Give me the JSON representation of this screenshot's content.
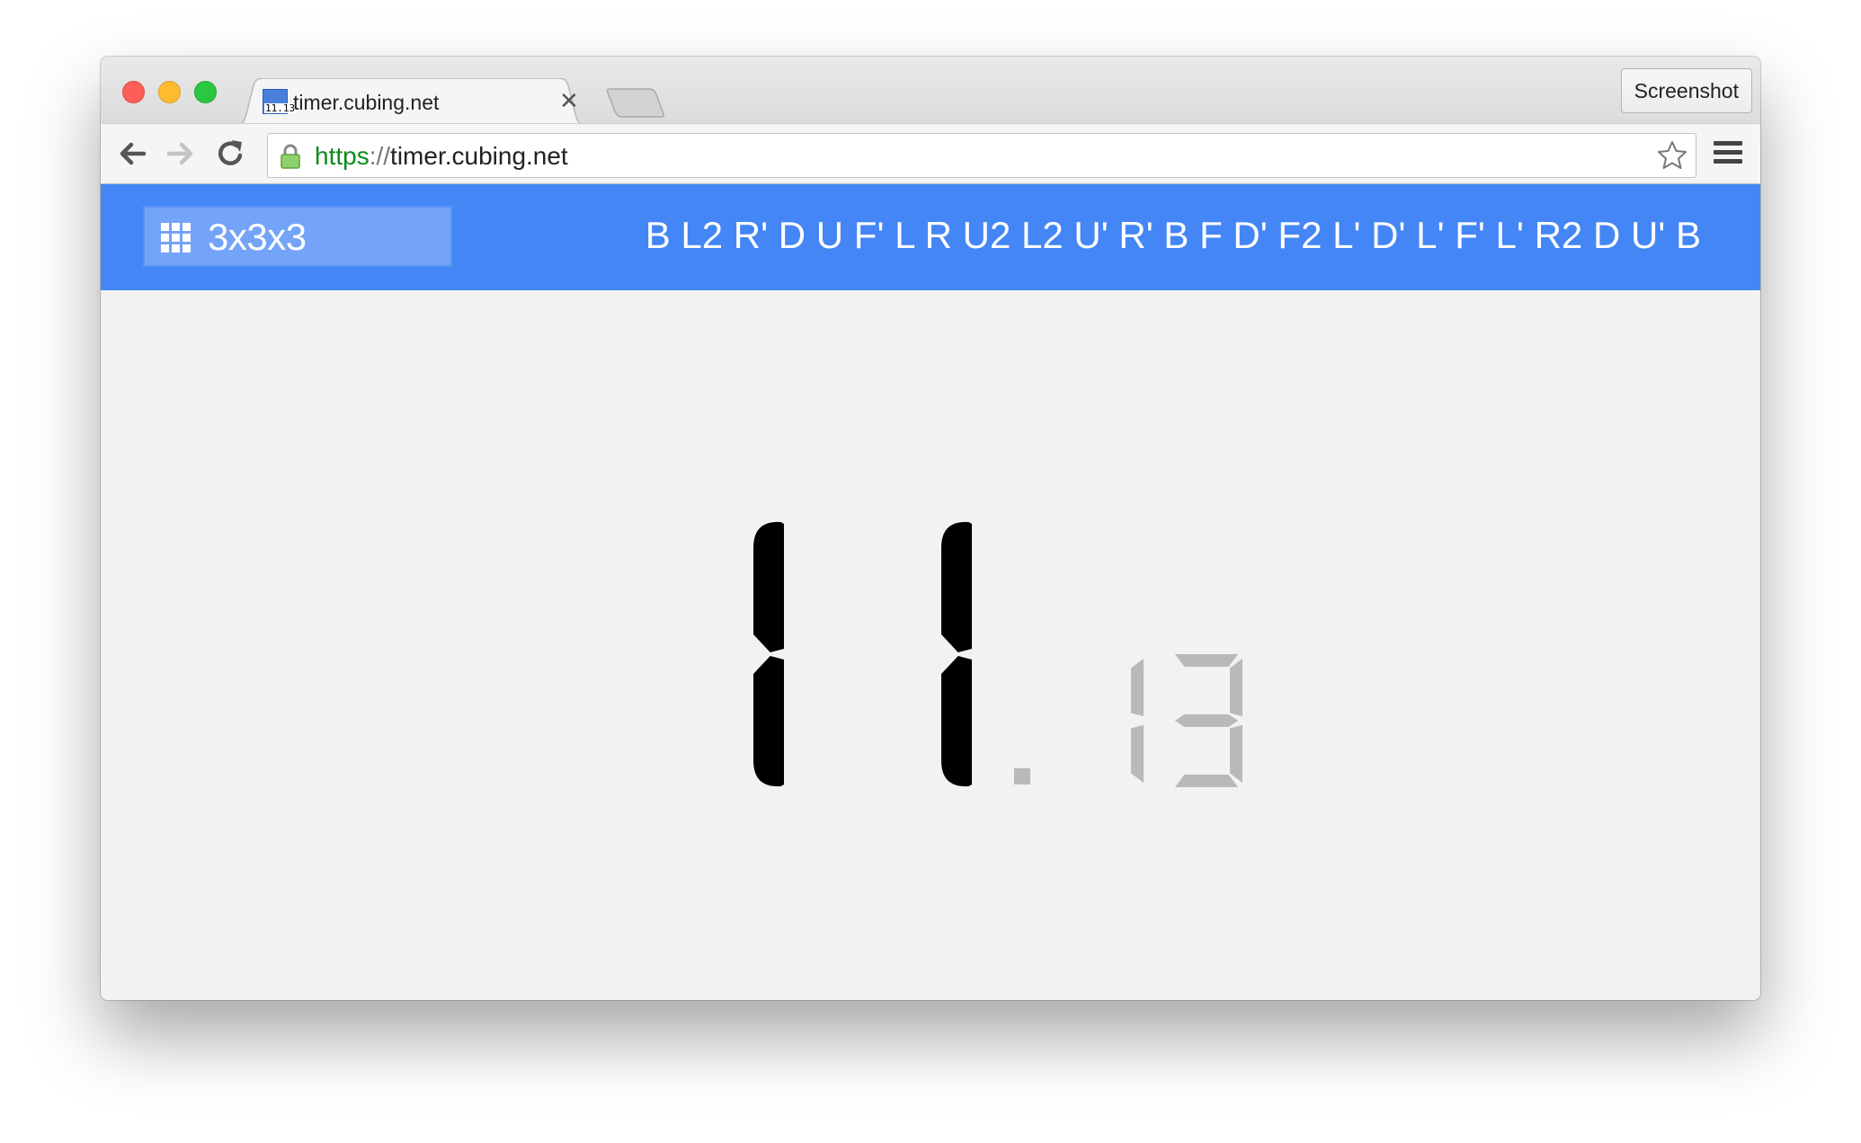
{
  "browser": {
    "tab_title": "timer.cubing.net",
    "favicon_text": "11.13",
    "screenshot_button": "Screenshot",
    "url_scheme": "https",
    "url_separator": "://",
    "url_host": "timer.cubing.net"
  },
  "app": {
    "event_label": "3x3x3",
    "scramble": "B L2 R' D U F' L R U2 L2 U' R' B F D' F2 L' D' L' F' L' R2 D U' B",
    "timer": {
      "seconds": "11",
      "separator": ".",
      "fraction": "13"
    }
  },
  "colors": {
    "header_blue": "#4486f5",
    "event_select_bg": "#74a4f8",
    "timer_primary": "#000000",
    "timer_secondary": "#b9b9b9",
    "url_scheme_green": "#0b8a1d"
  },
  "icons": [
    "close-window-icon",
    "minimize-window-icon",
    "maximize-window-icon",
    "favicon-icon",
    "tab-close-icon",
    "back-arrow-icon",
    "forward-arrow-icon",
    "reload-icon",
    "lock-icon",
    "star-icon",
    "menu-icon",
    "grid-icon"
  ]
}
